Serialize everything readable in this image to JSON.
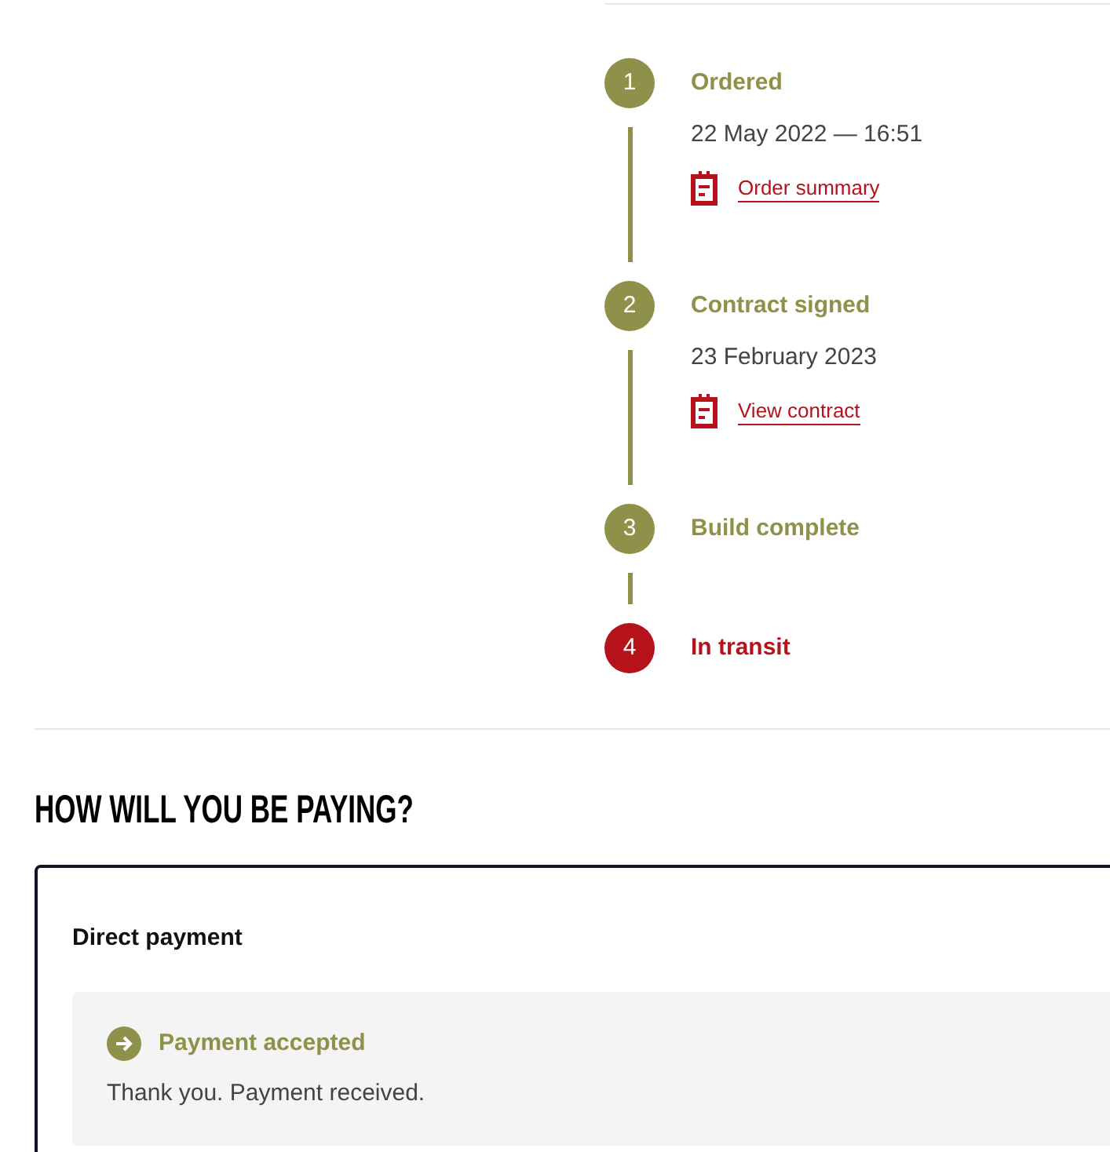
{
  "timeline": [
    {
      "number": "1",
      "title": "Ordered",
      "current": false,
      "date": "22 May 2022 — 16:51",
      "link": "Order summary"
    },
    {
      "number": "2",
      "title": "Contract signed",
      "current": false,
      "date": "23 February 2023",
      "link": "View contract"
    },
    {
      "number": "3",
      "title": "Build complete",
      "current": false
    },
    {
      "number": "4",
      "title": "In transit",
      "current": true
    }
  ],
  "payment": {
    "heading": "HOW WILL YOU BE PAYING?",
    "method": "Direct payment",
    "notice_title": "Payment accepted",
    "notice_text": "Thank you. Payment received."
  }
}
